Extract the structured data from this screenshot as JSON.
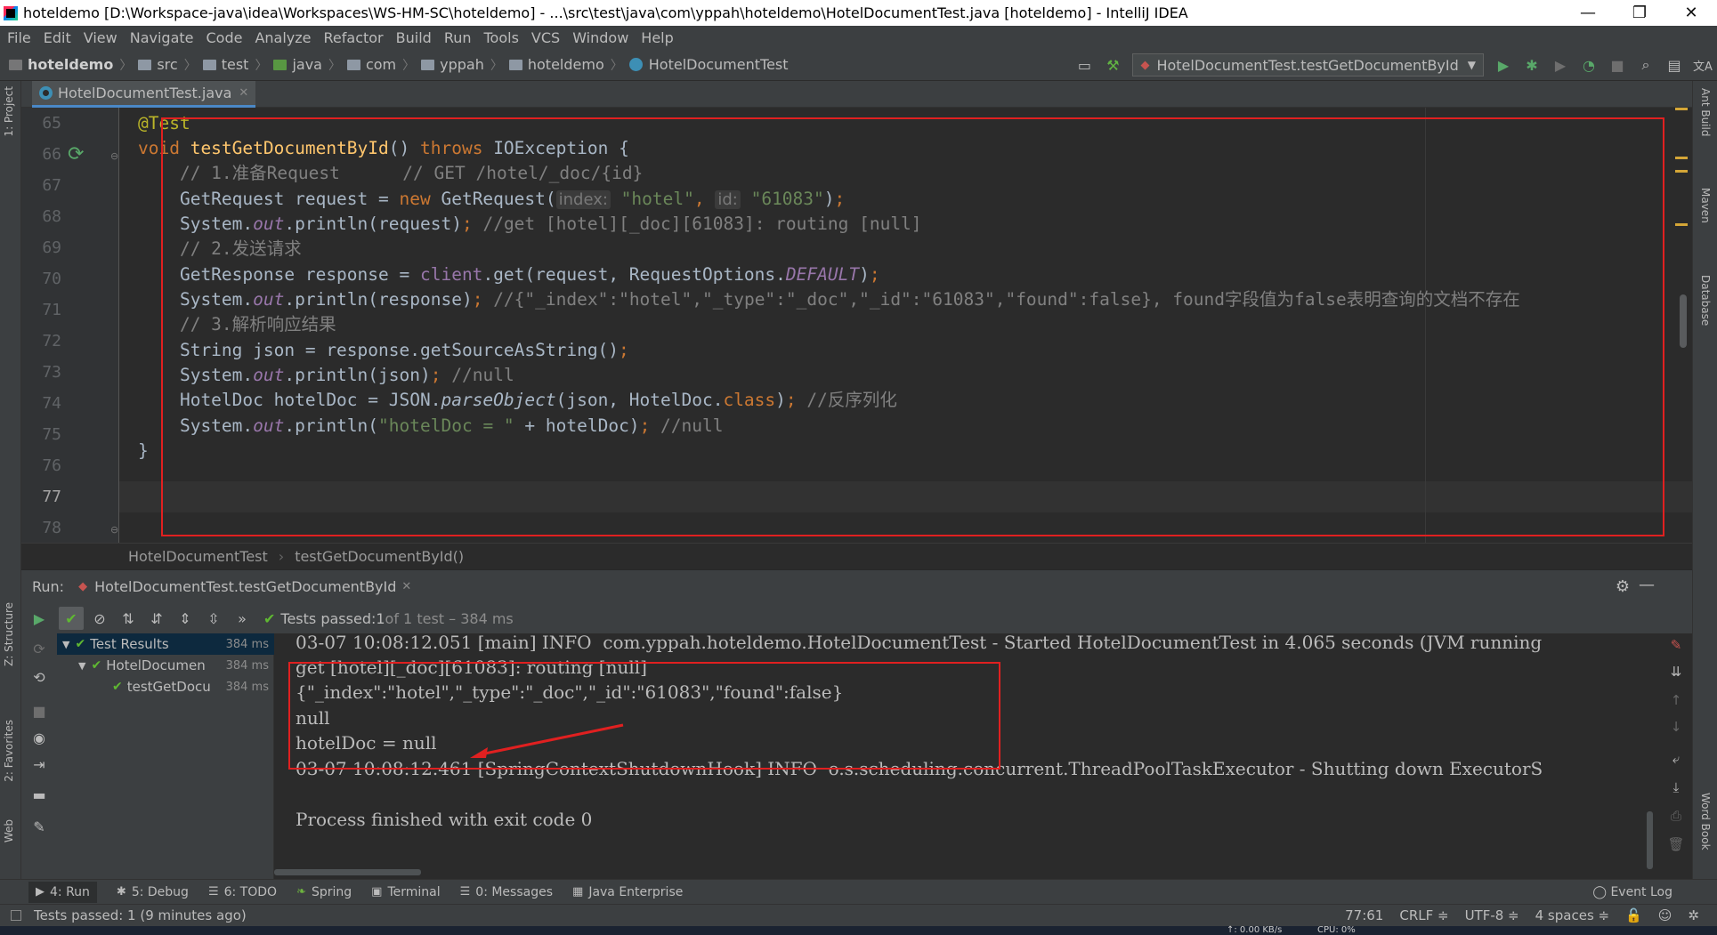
{
  "window": {
    "title": "hoteldemo [D:\\Workspace-java\\idea\\Workspaces\\WS-HM-SC\\hoteldemo] - ...\\src\\test\\java\\com\\yppah\\hoteldemo\\HotelDocumentTest.java [hoteldemo] - IntelliJ IDEA",
    "minimize": "—",
    "restore": "❐",
    "close": "✕"
  },
  "menu": [
    "File",
    "Edit",
    "View",
    "Navigate",
    "Code",
    "Analyze",
    "Refactor",
    "Build",
    "Run",
    "Tools",
    "VCS",
    "Window",
    "Help"
  ],
  "breadcrumbs": [
    "hoteldemo",
    "src",
    "test",
    "java",
    "com",
    "yppah",
    "hoteldemo",
    "HotelDocumentTest"
  ],
  "run_config": "HotelDocumentTest.testGetDocumentById",
  "left_tool_tabs": [
    "1: Project",
    "Z: Structure",
    "2: Favorites",
    "Web"
  ],
  "right_tool_tabs": [
    "Ant Build",
    "Maven",
    "Database",
    "Word Book"
  ],
  "editor_tab": "HotelDocumentTest.java",
  "editor": {
    "line_numbers": [
      "65",
      "66",
      "67",
      "68",
      "69",
      "70",
      "71",
      "72",
      "73",
      "74",
      "75",
      "76",
      "77",
      "78"
    ],
    "current_line": "77",
    "lines": {
      "l65": {
        "ann": "@Test"
      },
      "l66": {
        "kw1": "void ",
        "fn": "testGetDocumentById",
        "t1": "() ",
        "kw2": "throws",
        "t2": " IOException {"
      },
      "l67": {
        "cmt": "    // 1.准备Request      // GET /hotel/_doc/{id}"
      },
      "l68": {
        "t1": "    GetRequest request = ",
        "kw": "new",
        "t2": " GetRequest(",
        "hint1": "index:",
        "s1": " \"hotel\"",
        "t3": ", ",
        "hint2": "id:",
        "s2": " \"61083\"",
        "t4": ")",
        "semi": ";"
      },
      "l69": {
        "t1": "    System.",
        "fld": "out",
        "t2": ".println(request)",
        "semi": ";",
        "cmt": " //get [hotel][_doc][61083]: routing [null]"
      },
      "l70": {
        "cmt": "    // 2.发送请求"
      },
      "l71": {
        "t1": "    GetResponse response = ",
        "fld1": "client",
        "t2": ".get(request, RequestOptions.",
        "fld2": "DEFAULT",
        "t3": ")",
        "semi": ";"
      },
      "l72": {
        "t1": "    System.",
        "fld": "out",
        "t2": ".println(response)",
        "semi": ";",
        "cmt": " //{\"_index\":\"hotel\",\"_type\":\"_doc\",\"_id\":\"61083\",\"found\":false}, found字段值为false表明查询的文档不存在"
      },
      "l73": {
        "cmt": "    // 3.解析响应结果"
      },
      "l74": {
        "t1": "    String json = response.getSourceAsString()",
        "semi": ";"
      },
      "l75": {
        "t1": "    System.",
        "fld": "out",
        "t2": ".println(json)",
        "semi": ";",
        "cmt": " //null"
      },
      "l76": {
        "t1": "    HotelDoc hotelDoc = JSON.",
        "it": "parseObject",
        "t2": "(json, HotelDoc.",
        "kw": "class",
        "t3": ")",
        "semi": ";",
        "cmt": " //反序列化"
      },
      "l77": {
        "t1": "    System.",
        "fld": "out",
        "t2": ".println(",
        "s": "\"hotelDoc = \"",
        "t3": " + hotelDoc)",
        "semi": ";",
        "cmt": " //null"
      },
      "l78": {
        "t1": "}"
      }
    }
  },
  "editor_breadcrumb": [
    "HotelDocumentTest",
    "testGetDocumentById()"
  ],
  "run_panel": {
    "label": "Run:",
    "tab": "HotelDocumentTest.testGetDocumentById",
    "status_prefix": "Tests passed: ",
    "status_count": "1",
    "status_suffix": " of 1 test – 384 ms",
    "tree": [
      {
        "label": "Test Results",
        "time": "384 ms"
      },
      {
        "label": "HotelDocumen",
        "time": "384 ms"
      },
      {
        "label": "testGetDocu",
        "time": "384 ms"
      }
    ],
    "console": [
      "03-07 10:08:12.051 [main] INFO  com.yppah.hoteldemo.HotelDocumentTest - Started HotelDocumentTest in 4.065 seconds (JVM running",
      "get [hotel][_doc][61083]: routing [null]",
      "{\"_index\":\"hotel\",\"_type\":\"_doc\",\"_id\":\"61083\",\"found\":false}",
      "null",
      "hotelDoc = null",
      "03-07 10:08:12.461 [SpringContextShutdownHook] INFO  o.s.scheduling.concurrent.ThreadPoolTaskExecutor - Shutting down ExecutorS",
      "",
      "Process finished with exit code 0"
    ]
  },
  "bottom_tabs": [
    {
      "icon": "▶",
      "label": "4: Run"
    },
    {
      "icon": "✱",
      "label": "5: Debug"
    },
    {
      "icon": "☰",
      "label": "6: TODO"
    },
    {
      "icon": "❧",
      "label": "Spring"
    },
    {
      "icon": "▣",
      "label": "Terminal"
    },
    {
      "icon": "☰",
      "label": "0: Messages"
    },
    {
      "icon": "▦",
      "label": "Java Enterprise"
    }
  ],
  "event_log": "Event Log",
  "status_bar": {
    "message": "Tests passed: 1 (9 minutes ago)",
    "position": "77:61",
    "line_sep": "CRLF ≑",
    "encoding": "UTF-8 ≑",
    "indent": "4 spaces ≑"
  },
  "taskbar": {
    "net": "↑: 0.00 KB/s",
    "cpu": "CPU: 0%"
  },
  "colors": {
    "keyword": "#cc7832",
    "string": "#6a8759",
    "comment": "#808080",
    "annotation": "#bbb529",
    "method": "#ffc66d",
    "field": "#9876aa",
    "highlight_box": "#e02020",
    "pass": "#5fb832"
  }
}
